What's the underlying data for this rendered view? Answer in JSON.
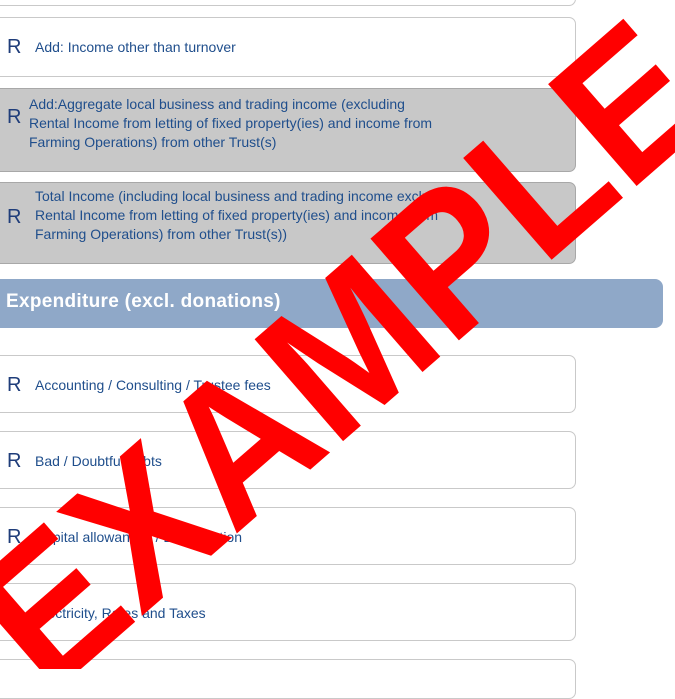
{
  "income_rows": [
    {
      "symbol": "R",
      "label": "Add: Income other than turnover"
    },
    {
      "symbol": "R",
      "label_lines": [
        "Add:Aggregate local business and trading income (excluding",
        "Rental Income from letting of fixed property(ies) and income from",
        "Farming Operations) from other Trust(s)"
      ]
    },
    {
      "symbol": "R",
      "label_lines": [
        "Total Income (including local business and trading income excluding",
        "Rental Income from letting of fixed property(ies) and income from",
        "Farming Operations) from other Trust(s))"
      ]
    }
  ],
  "section": {
    "title": "Expenditure (excl. donations)"
  },
  "expenditure_rows": [
    {
      "symbol": "R",
      "label": "Accounting / Consulting / Trustee fees"
    },
    {
      "symbol": "R",
      "label": "Bad / Doubtful debts"
    },
    {
      "symbol": "R",
      "label": "Capital allowances / Depreciation"
    },
    {
      "symbol": "R",
      "label": "Electricity, Rates and Taxes"
    }
  ],
  "watermark": {
    "text": "EXAMPLE",
    "color": "#ff0000"
  },
  "colors": {
    "label_text": "#1f4e8c",
    "section_bar": "#8fa8c8",
    "grey_box": "#c8c8c8"
  }
}
